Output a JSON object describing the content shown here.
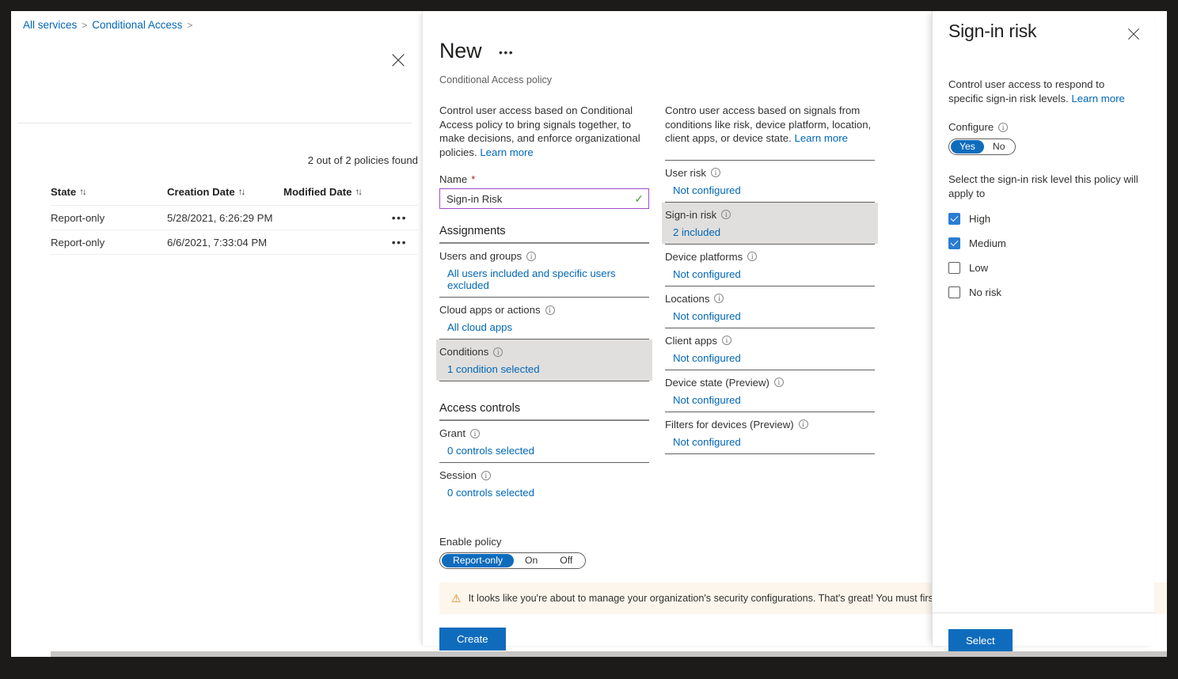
{
  "breadcrumb": {
    "items": [
      "All services",
      "Conditional Access"
    ],
    "separator": ">"
  },
  "list_blade": {
    "close_icon": "close-icon",
    "count_text": "2 out of 2 policies found",
    "columns": [
      "State",
      "Creation Date",
      "Modified Date"
    ],
    "sort_glyph": "↑↓",
    "rows": [
      {
        "state": "Report-only",
        "created": "5/28/2021, 6:26:29 PM",
        "modified": "",
        "menu": "•••"
      },
      {
        "state": "Report-only",
        "created": "6/6/2021, 7:33:04 PM",
        "modified": "",
        "menu": "•••"
      }
    ]
  },
  "new_blade": {
    "title": "New",
    "ellipsis": "•••",
    "subtitle": "Conditional Access policy",
    "description": "Control user access based on Conditional Access policy to bring signals together, to make decisions, and enforce organizational policies.",
    "learn_more": "Learn more",
    "name_label": "Name",
    "required_mark": "*",
    "name_value": "Sign-in Risk",
    "name_placeholder": "Name",
    "name_valid_icon": "✓",
    "assignments_heading": "Assignments",
    "assignments": [
      {
        "label": "Users and groups",
        "value": "All users included and specific users excluded",
        "selected": false
      },
      {
        "label": "Cloud apps or actions",
        "value": "All cloud apps",
        "selected": false
      },
      {
        "label": "Conditions",
        "value": "1 condition selected",
        "selected": true
      }
    ],
    "access_controls_heading": "Access controls",
    "access_controls": [
      {
        "label": "Grant",
        "value": "0 controls selected",
        "selected": false
      },
      {
        "label": "Session",
        "value": "0 controls selected",
        "selected": false
      }
    ],
    "conditions_description": "Contro user access based on signals from conditions like risk, device platform, location, client apps, or device state.",
    "conditions_learn_more": "Learn more",
    "conditions": [
      {
        "label": "User risk",
        "value": "Not configured",
        "selected": false
      },
      {
        "label": "Sign-in risk",
        "value": "2 included",
        "selected": true
      },
      {
        "label": "Device platforms",
        "value": "Not configured",
        "selected": false
      },
      {
        "label": "Locations",
        "value": "Not configured",
        "selected": false
      },
      {
        "label": "Client apps",
        "value": "Not configured",
        "selected": false
      },
      {
        "label": "Device state (Preview)",
        "value": "Not configured",
        "selected": false
      },
      {
        "label": "Filters for devices (Preview)",
        "value": "Not configured",
        "selected": false
      }
    ],
    "enable_policy_label": "Enable policy",
    "enable_options": [
      "Report-only",
      "On",
      "Off"
    ],
    "enable_selected": "Report-only",
    "warning_icon": "warning-icon",
    "warning_text": "It looks like you're about to manage your organization's security configurations. That's great! You must first disabl",
    "create_label": "Create"
  },
  "risk_panel": {
    "title": "Sign-in risk",
    "close_icon": "close-icon",
    "description": "Control user access to respond to specific sign-in risk levels.",
    "learn_more": "Learn more",
    "configure_label": "Configure",
    "configure_options": [
      "Yes",
      "No"
    ],
    "configure_selected": "Yes",
    "select_prompt": "Select the sign-in risk level this policy will apply to",
    "levels": [
      {
        "label": "High",
        "checked": true
      },
      {
        "label": "Medium",
        "checked": true
      },
      {
        "label": "Low",
        "checked": false
      },
      {
        "label": "No risk",
        "checked": false
      }
    ],
    "select_button": "Select"
  },
  "colors": {
    "accent": "#0f6cbd",
    "link": "#0067b8",
    "selected_row": "#e1dfdd",
    "warning_bg": "#fdf6ec",
    "warning_icon": "#e08317",
    "name_border": "#a24dca",
    "valid_check": "#4f9a3e",
    "checkbox_checked": "#2b7cd3"
  }
}
